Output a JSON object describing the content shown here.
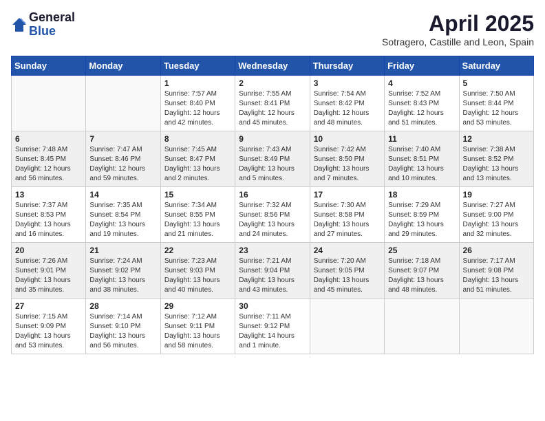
{
  "logo": {
    "general": "General",
    "blue": "Blue"
  },
  "title": "April 2025",
  "subtitle": "Sotragero, Castille and Leon, Spain",
  "days_of_week": [
    "Sunday",
    "Monday",
    "Tuesday",
    "Wednesday",
    "Thursday",
    "Friday",
    "Saturday"
  ],
  "weeks": [
    [
      {
        "day": "",
        "info": ""
      },
      {
        "day": "",
        "info": ""
      },
      {
        "day": "1",
        "info": "Sunrise: 7:57 AM\nSunset: 8:40 PM\nDaylight: 12 hours and 42 minutes."
      },
      {
        "day": "2",
        "info": "Sunrise: 7:55 AM\nSunset: 8:41 PM\nDaylight: 12 hours and 45 minutes."
      },
      {
        "day": "3",
        "info": "Sunrise: 7:54 AM\nSunset: 8:42 PM\nDaylight: 12 hours and 48 minutes."
      },
      {
        "day": "4",
        "info": "Sunrise: 7:52 AM\nSunset: 8:43 PM\nDaylight: 12 hours and 51 minutes."
      },
      {
        "day": "5",
        "info": "Sunrise: 7:50 AM\nSunset: 8:44 PM\nDaylight: 12 hours and 53 minutes."
      }
    ],
    [
      {
        "day": "6",
        "info": "Sunrise: 7:48 AM\nSunset: 8:45 PM\nDaylight: 12 hours and 56 minutes."
      },
      {
        "day": "7",
        "info": "Sunrise: 7:47 AM\nSunset: 8:46 PM\nDaylight: 12 hours and 59 minutes."
      },
      {
        "day": "8",
        "info": "Sunrise: 7:45 AM\nSunset: 8:47 PM\nDaylight: 13 hours and 2 minutes."
      },
      {
        "day": "9",
        "info": "Sunrise: 7:43 AM\nSunset: 8:49 PM\nDaylight: 13 hours and 5 minutes."
      },
      {
        "day": "10",
        "info": "Sunrise: 7:42 AM\nSunset: 8:50 PM\nDaylight: 13 hours and 7 minutes."
      },
      {
        "day": "11",
        "info": "Sunrise: 7:40 AM\nSunset: 8:51 PM\nDaylight: 13 hours and 10 minutes."
      },
      {
        "day": "12",
        "info": "Sunrise: 7:38 AM\nSunset: 8:52 PM\nDaylight: 13 hours and 13 minutes."
      }
    ],
    [
      {
        "day": "13",
        "info": "Sunrise: 7:37 AM\nSunset: 8:53 PM\nDaylight: 13 hours and 16 minutes."
      },
      {
        "day": "14",
        "info": "Sunrise: 7:35 AM\nSunset: 8:54 PM\nDaylight: 13 hours and 19 minutes."
      },
      {
        "day": "15",
        "info": "Sunrise: 7:34 AM\nSunset: 8:55 PM\nDaylight: 13 hours and 21 minutes."
      },
      {
        "day": "16",
        "info": "Sunrise: 7:32 AM\nSunset: 8:56 PM\nDaylight: 13 hours and 24 minutes."
      },
      {
        "day": "17",
        "info": "Sunrise: 7:30 AM\nSunset: 8:58 PM\nDaylight: 13 hours and 27 minutes."
      },
      {
        "day": "18",
        "info": "Sunrise: 7:29 AM\nSunset: 8:59 PM\nDaylight: 13 hours and 29 minutes."
      },
      {
        "day": "19",
        "info": "Sunrise: 7:27 AM\nSunset: 9:00 PM\nDaylight: 13 hours and 32 minutes."
      }
    ],
    [
      {
        "day": "20",
        "info": "Sunrise: 7:26 AM\nSunset: 9:01 PM\nDaylight: 13 hours and 35 minutes."
      },
      {
        "day": "21",
        "info": "Sunrise: 7:24 AM\nSunset: 9:02 PM\nDaylight: 13 hours and 38 minutes."
      },
      {
        "day": "22",
        "info": "Sunrise: 7:23 AM\nSunset: 9:03 PM\nDaylight: 13 hours and 40 minutes."
      },
      {
        "day": "23",
        "info": "Sunrise: 7:21 AM\nSunset: 9:04 PM\nDaylight: 13 hours and 43 minutes."
      },
      {
        "day": "24",
        "info": "Sunrise: 7:20 AM\nSunset: 9:05 PM\nDaylight: 13 hours and 45 minutes."
      },
      {
        "day": "25",
        "info": "Sunrise: 7:18 AM\nSunset: 9:07 PM\nDaylight: 13 hours and 48 minutes."
      },
      {
        "day": "26",
        "info": "Sunrise: 7:17 AM\nSunset: 9:08 PM\nDaylight: 13 hours and 51 minutes."
      }
    ],
    [
      {
        "day": "27",
        "info": "Sunrise: 7:15 AM\nSunset: 9:09 PM\nDaylight: 13 hours and 53 minutes."
      },
      {
        "day": "28",
        "info": "Sunrise: 7:14 AM\nSunset: 9:10 PM\nDaylight: 13 hours and 56 minutes."
      },
      {
        "day": "29",
        "info": "Sunrise: 7:12 AM\nSunset: 9:11 PM\nDaylight: 13 hours and 58 minutes."
      },
      {
        "day": "30",
        "info": "Sunrise: 7:11 AM\nSunset: 9:12 PM\nDaylight: 14 hours and 1 minute."
      },
      {
        "day": "",
        "info": ""
      },
      {
        "day": "",
        "info": ""
      },
      {
        "day": "",
        "info": ""
      }
    ]
  ]
}
